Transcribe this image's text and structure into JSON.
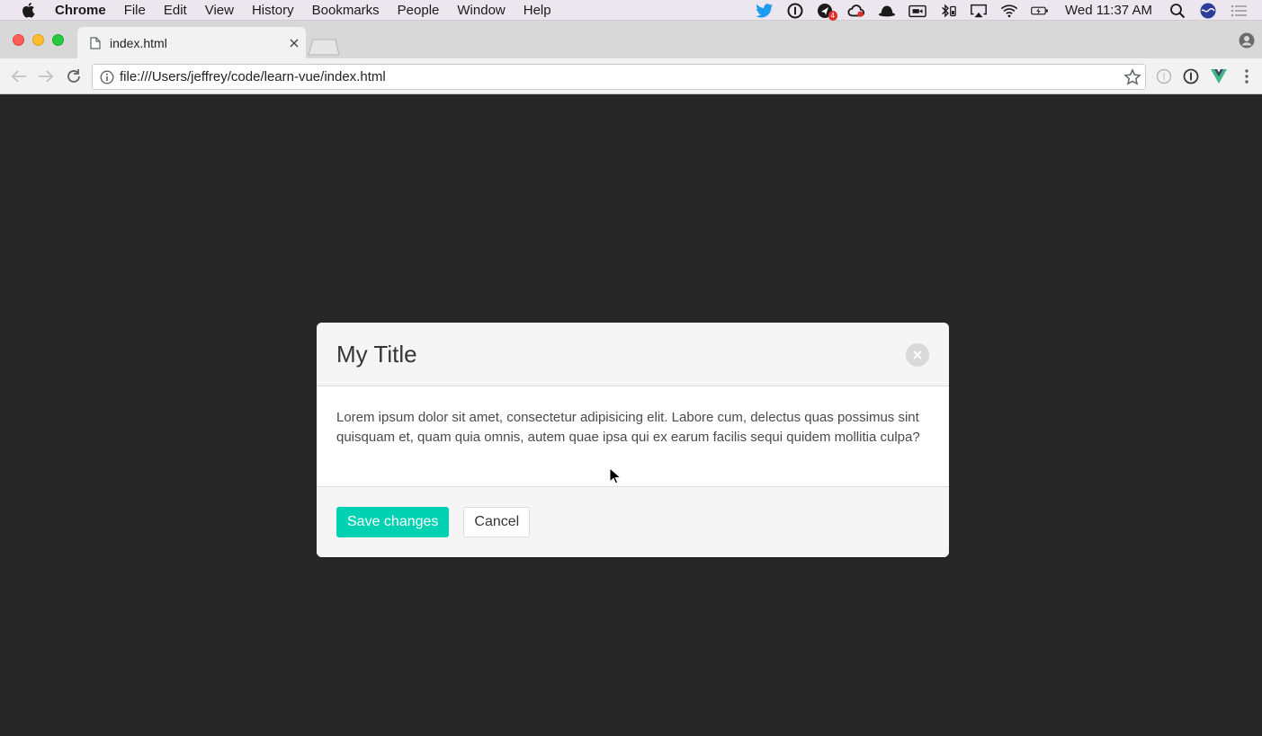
{
  "menubar": {
    "app_name": "Chrome",
    "items": [
      "File",
      "Edit",
      "View",
      "History",
      "Bookmarks",
      "People",
      "Window",
      "Help"
    ],
    "clock": "Wed 11:37 AM",
    "notification_count": "4"
  },
  "browser": {
    "tab_title": "index.html",
    "url": "file:///Users/jeffrey/code/learn-vue/index.html"
  },
  "modal": {
    "title": "My Title",
    "body": "Lorem ipsum dolor sit amet, consectetur adipisicing elit. Labore cum, delectus quas possimus sint quisquam et, quam quia omnis, autem quae ipsa qui ex earum facilis sequi quidem mollitia culpa?",
    "save_label": "Save changes",
    "cancel_label": "Cancel"
  },
  "colors": {
    "primary": "#00d1b2",
    "page_background": "#262626"
  }
}
